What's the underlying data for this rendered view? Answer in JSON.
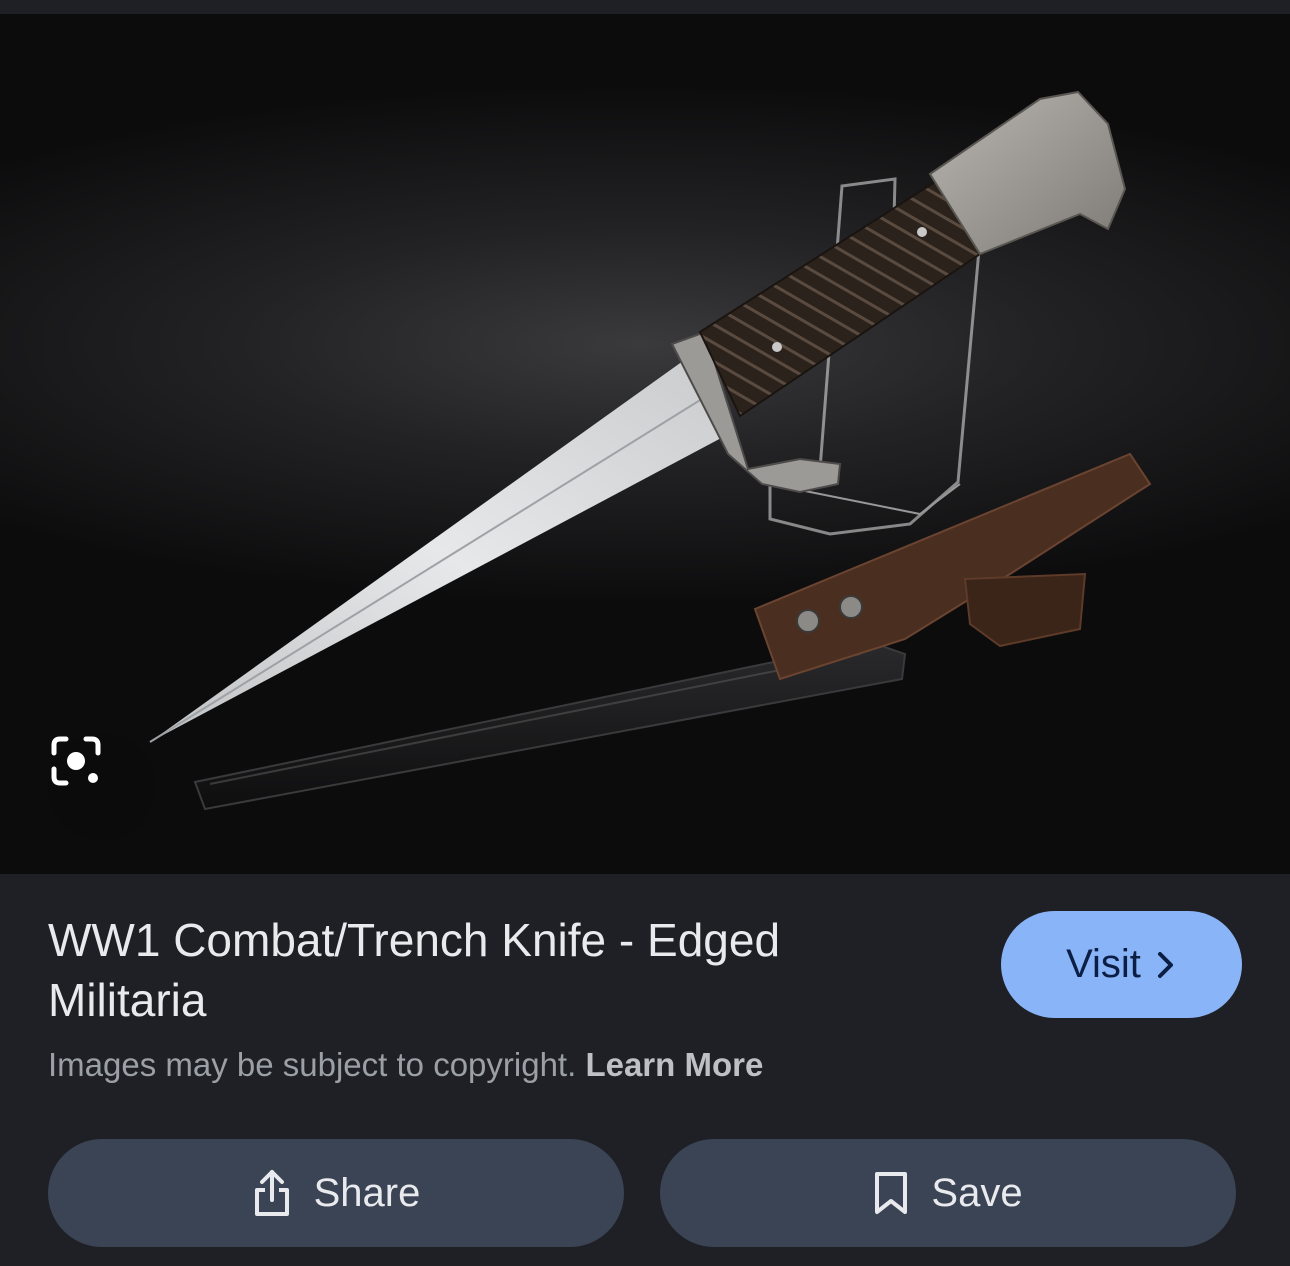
{
  "image": {
    "subject": "WW1 trench knife with scabbard on acrylic stand",
    "lens_button_icon": "google-lens-icon"
  },
  "result": {
    "title": "WW1 Combat/Trench Knife - Edged Militaria",
    "visit_label": "Visit",
    "visit_icon": "chevron-right-icon",
    "copyright_text": "Images may be subject to copyright.",
    "learn_more_label": "Learn More"
  },
  "actions": {
    "share_label": "Share",
    "share_icon": "share-icon",
    "save_label": "Save",
    "save_icon": "bookmark-icon"
  },
  "colors": {
    "background": "#1f2025",
    "visit_button": "#8ab4f8",
    "action_button": "#3b4454"
  }
}
